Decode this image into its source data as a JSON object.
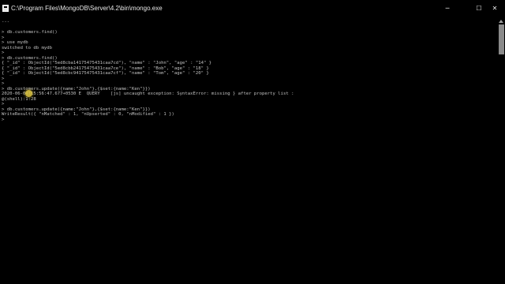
{
  "window": {
    "title": "C:\\Program Files\\MongoDB\\Server\\4.2\\bin\\mongo.exe",
    "controls": {
      "minimize": "─",
      "maximize": "☐",
      "close": "✕"
    }
  },
  "console": {
    "lines": [
      "---",
      "",
      "> db.customers.find()",
      ">",
      "> use mydb",
      "switched to db mydb",
      ">",
      "> db.customers.find()",
      "{ \"_id\" : ObjectId(\"5ed8cba14175475431caa7cd\"), \"name\" : \"John\", \"age\" : \"14\" }",
      "{ \"_id\" : ObjectId(\"5ed8cbb24175475431caa7ce\"), \"name\" : \"Bob\", \"age\" : \"18\" }",
      "{ \"_id\" : ObjectId(\"5ed8cbc94175475431caa7cf\"), \"name\" : \"Tom\", \"age\" : \"20\" }",
      ">",
      ">",
      "> db.customers.update({name:\"John\"},{$set:{name:\"Ken\"}})",
      "2020-06-04T15:56:47.677+0530 E  QUERY    [js] uncaught exception: SyntaxError: missing } after property list :",
      "@(shell):1:28",
      ">",
      "> db.customers.update({name:\"John\"},{$set:{name:\"Ken\"}})",
      "WriteResult({ \"nMatched\" : 1, \"nUpserted\" : 0, \"nModified\" : 1 })",
      ">"
    ]
  }
}
